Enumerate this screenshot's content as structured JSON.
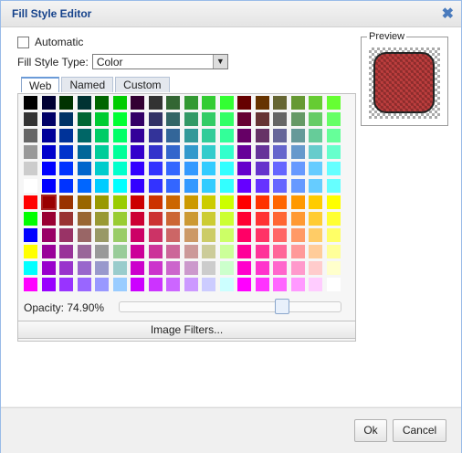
{
  "dialog": {
    "title": "Fill Style Editor",
    "close_glyph": "✖"
  },
  "automatic_label": "Automatic",
  "automatic_checked": false,
  "fill_style_type": {
    "label": "Fill Style Type:",
    "value": "Color",
    "arrow": "▼"
  },
  "tabs": [
    "Web",
    "Named",
    "Custom"
  ],
  "active_tab": "Web",
  "opacity": {
    "label": "Opacity:",
    "value": "74.90%",
    "fraction": 0.749
  },
  "image_filters_label": "Image Filters...",
  "preview_label": "Preview",
  "preview_fill_color": "#b52b2b",
  "buttons": {
    "ok": "Ok",
    "cancel": "Cancel"
  },
  "palette": {
    "rows": 12,
    "cols": 18,
    "selected": {
      "row": 6,
      "col": 1
    },
    "colors": [
      [
        "#000000",
        "#000033",
        "#003300",
        "#003333",
        "#006600",
        "#00cc00",
        "#330033",
        "#333333",
        "#336633",
        "#339933",
        "#33cc33",
        "#33ff33",
        "#660000",
        "#663300",
        "#666633",
        "#669933",
        "#66cc33",
        "#66ff33"
      ],
      [
        "#333333",
        "#000066",
        "#003366",
        "#006633",
        "#00cc33",
        "#00ff33",
        "#330066",
        "#333366",
        "#336666",
        "#339966",
        "#33cc66",
        "#33ff66",
        "#660033",
        "#663333",
        "#666666",
        "#669966",
        "#66cc66",
        "#66ff66"
      ],
      [
        "#666666",
        "#000099",
        "#003399",
        "#006666",
        "#00cc66",
        "#00ff66",
        "#330099",
        "#333399",
        "#336699",
        "#339999",
        "#33cc99",
        "#33ff99",
        "#660066",
        "#663366",
        "#666699",
        "#669999",
        "#66cc99",
        "#66ff99"
      ],
      [
        "#999999",
        "#0000cc",
        "#0033cc",
        "#006699",
        "#00cc99",
        "#00ff99",
        "#3300cc",
        "#3333cc",
        "#3366cc",
        "#3399cc",
        "#33cccc",
        "#33ffcc",
        "#660099",
        "#663399",
        "#6666cc",
        "#6699cc",
        "#66cccc",
        "#66ffcc"
      ],
      [
        "#cccccc",
        "#0000ff",
        "#0033ff",
        "#0066cc",
        "#00cccc",
        "#00ffcc",
        "#3300ff",
        "#3333ff",
        "#3366ff",
        "#3399ff",
        "#33ccff",
        "#33ffff",
        "#6600cc",
        "#6633cc",
        "#6666ff",
        "#6699ff",
        "#66ccff",
        "#66ffff"
      ],
      [
        "#ffffff",
        "#0000ff",
        "#0033ff",
        "#0066ff",
        "#00ccff",
        "#00ffff",
        "#3300ff",
        "#3333ff",
        "#3366ff",
        "#3399ff",
        "#33ccff",
        "#33ffff",
        "#6600ff",
        "#6633ff",
        "#6666ff",
        "#6699ff",
        "#66ccff",
        "#66ffff"
      ],
      [
        "#ff0000",
        "#990000",
        "#993300",
        "#996600",
        "#999900",
        "#99cc00",
        "#cc0000",
        "#cc3300",
        "#cc6600",
        "#cc9900",
        "#cccc00",
        "#ccff00",
        "#ff0000",
        "#ff3300",
        "#ff6600",
        "#ff9900",
        "#ffcc00",
        "#ffff00"
      ],
      [
        "#00ff00",
        "#990033",
        "#993333",
        "#996633",
        "#999933",
        "#99cc33",
        "#cc0033",
        "#cc3333",
        "#cc6633",
        "#cc9933",
        "#cccc33",
        "#ccff33",
        "#ff0033",
        "#ff3333",
        "#ff6633",
        "#ff9933",
        "#ffcc33",
        "#ffff33"
      ],
      [
        "#0000ff",
        "#990066",
        "#993366",
        "#996666",
        "#999966",
        "#99cc66",
        "#cc0066",
        "#cc3366",
        "#cc6666",
        "#cc9966",
        "#cccc66",
        "#ccff66",
        "#ff0066",
        "#ff3366",
        "#ff6666",
        "#ff9966",
        "#ffcc66",
        "#ffff66"
      ],
      [
        "#ffff00",
        "#990099",
        "#993399",
        "#996699",
        "#999999",
        "#99cc99",
        "#cc0099",
        "#cc3399",
        "#cc6699",
        "#cc9999",
        "#cccc99",
        "#ccff99",
        "#ff0099",
        "#ff3399",
        "#ff6699",
        "#ff9999",
        "#ffcc99",
        "#ffff99"
      ],
      [
        "#00ffff",
        "#9900cc",
        "#9933cc",
        "#9966cc",
        "#9999cc",
        "#99cccc",
        "#cc00cc",
        "#cc33cc",
        "#cc66cc",
        "#cc99cc",
        "#cccccc",
        "#ccffcc",
        "#ff00cc",
        "#ff33cc",
        "#ff66cc",
        "#ff99cc",
        "#ffcccc",
        "#ffffcc"
      ],
      [
        "#ff00ff",
        "#9900ff",
        "#9933ff",
        "#9966ff",
        "#9999ff",
        "#99ccff",
        "#cc00ff",
        "#cc33ff",
        "#cc66ff",
        "#cc99ff",
        "#ccccff",
        "#ccffff",
        "#ff00ff",
        "#ff33ff",
        "#ff66ff",
        "#ff99ff",
        "#ffccff",
        "#ffffff"
      ]
    ]
  }
}
